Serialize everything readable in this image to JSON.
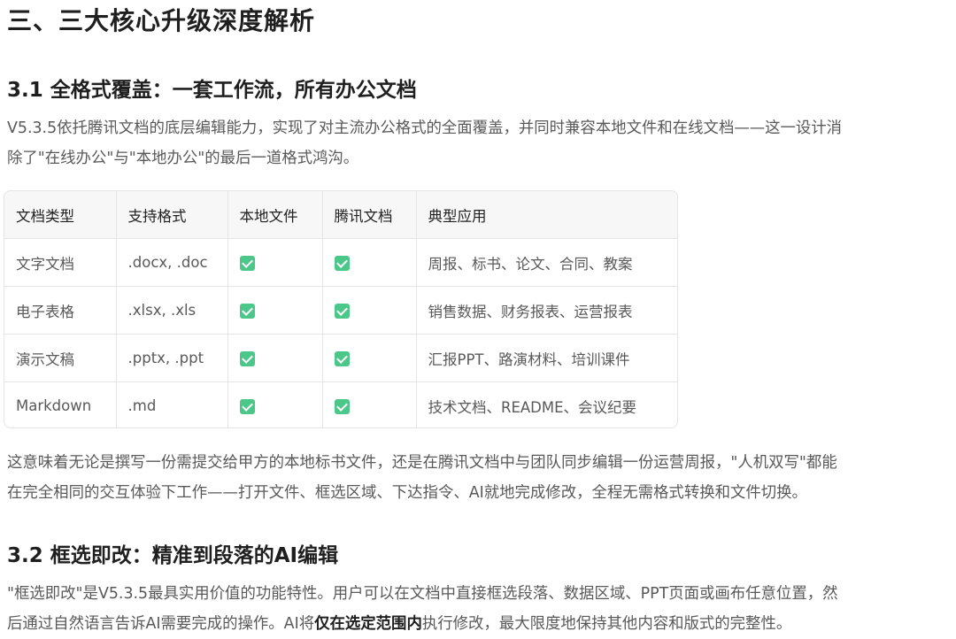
{
  "section_title": "三、三大核心升级深度解析",
  "s31": {
    "title": "3.1 全格式覆盖：一套工作流，所有办公文档",
    "intro_lines": [
      "V5.3.5依托腾讯文档的底层编辑能力，实现了对主流办公格式的全面覆盖，并同时兼容本地文件和在线文档——这一设计消",
      "除了\"在线办公\"与\"本地办公\"的最后一道格式鸿沟。"
    ],
    "table": {
      "headers": [
        "文档类型",
        "支持格式",
        "本地文件",
        "腾讯文档",
        "典型应用"
      ],
      "rows": [
        {
          "type": "文字文档",
          "formats": ".docx, .doc",
          "local": true,
          "tencent": true,
          "usage": "周报、标书、论文、合同、教案"
        },
        {
          "type": "电子表格",
          "formats": ".xlsx, .xls",
          "local": true,
          "tencent": true,
          "usage": "销售数据、财务报表、运营报表"
        },
        {
          "type": "演示文稿",
          "formats": ".pptx, .ppt",
          "local": true,
          "tencent": true,
          "usage": "汇报PPT、路演材料、培训课件"
        },
        {
          "type": "Markdown",
          "formats": ".md",
          "local": true,
          "tencent": true,
          "usage": "技术文档、README、会议纪要"
        }
      ],
      "check_icon": "checkbox-checked-icon",
      "check_color": "#4cc78a"
    },
    "outro_lines": [
      "这意味着无论是撰写一份需提交给甲方的本地标书文件，还是在腾讯文档中与团队同步编辑一份运营周报，\"人机双写\"都能",
      "在完全相同的交互体验下工作——打开文件、框选区域、下达指令、AI就地完成修改，全程无需格式转换和文件切换。"
    ]
  },
  "s32": {
    "title": "3.2 框选即改：精准到段落的AI编辑",
    "line1": "\"框选即改\"是V5.3.5最具实用价值的功能特性。用户可以在文档中直接框选段落、数据区域、PPT页面或画布任意位置，然",
    "line2_pre": "后通过自然语言告诉AI需要完成的操作。AI将",
    "line2_bold": "仅在选定范围内",
    "line2_post": "执行修改，最大限度地保持其他内容和版式的完整性。"
  }
}
